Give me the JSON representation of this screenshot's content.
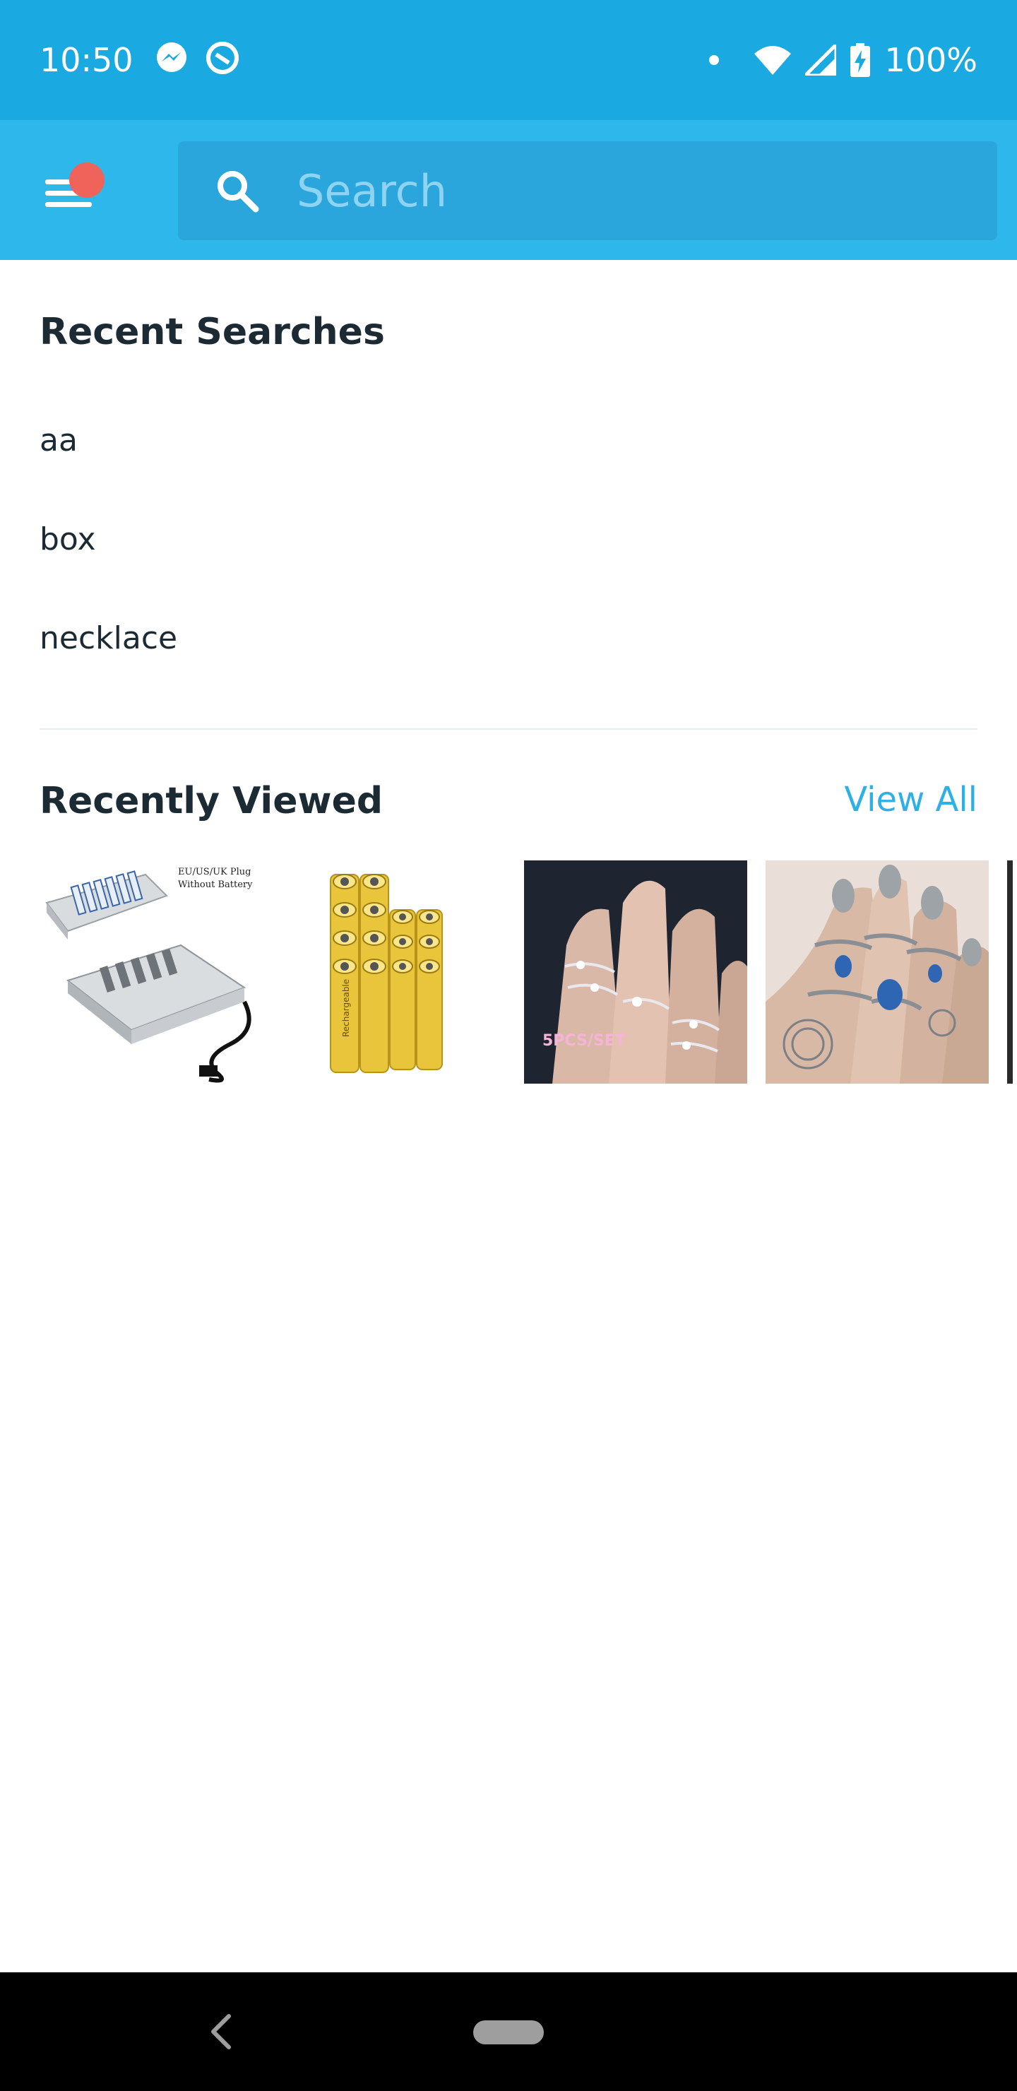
{
  "status_bar": {
    "time": "10:50",
    "battery": "100%",
    "icons": [
      "messenger-icon",
      "assistant-icon",
      "dot-icon",
      "wifi-icon",
      "signal-icon",
      "battery-charging-icon"
    ]
  },
  "search": {
    "placeholder": "Search"
  },
  "recent_searches": {
    "title": "Recent Searches",
    "items": [
      "aa",
      "box",
      "necklace"
    ]
  },
  "recently_viewed": {
    "title": "Recently Viewed",
    "view_all": "View All",
    "products": [
      {
        "label_line1": "EU/US/UK Plug",
        "label_line2": "Without Battery"
      },
      {
        "label": "Rechargeable"
      },
      {
        "label": "5PCS/SET"
      },
      {
        "label": ""
      }
    ]
  },
  "colors": {
    "status_bar": "#1ba9e1",
    "header": "#2eb7ea",
    "accent": "#2eb0e6",
    "badge": "#f0635a"
  }
}
